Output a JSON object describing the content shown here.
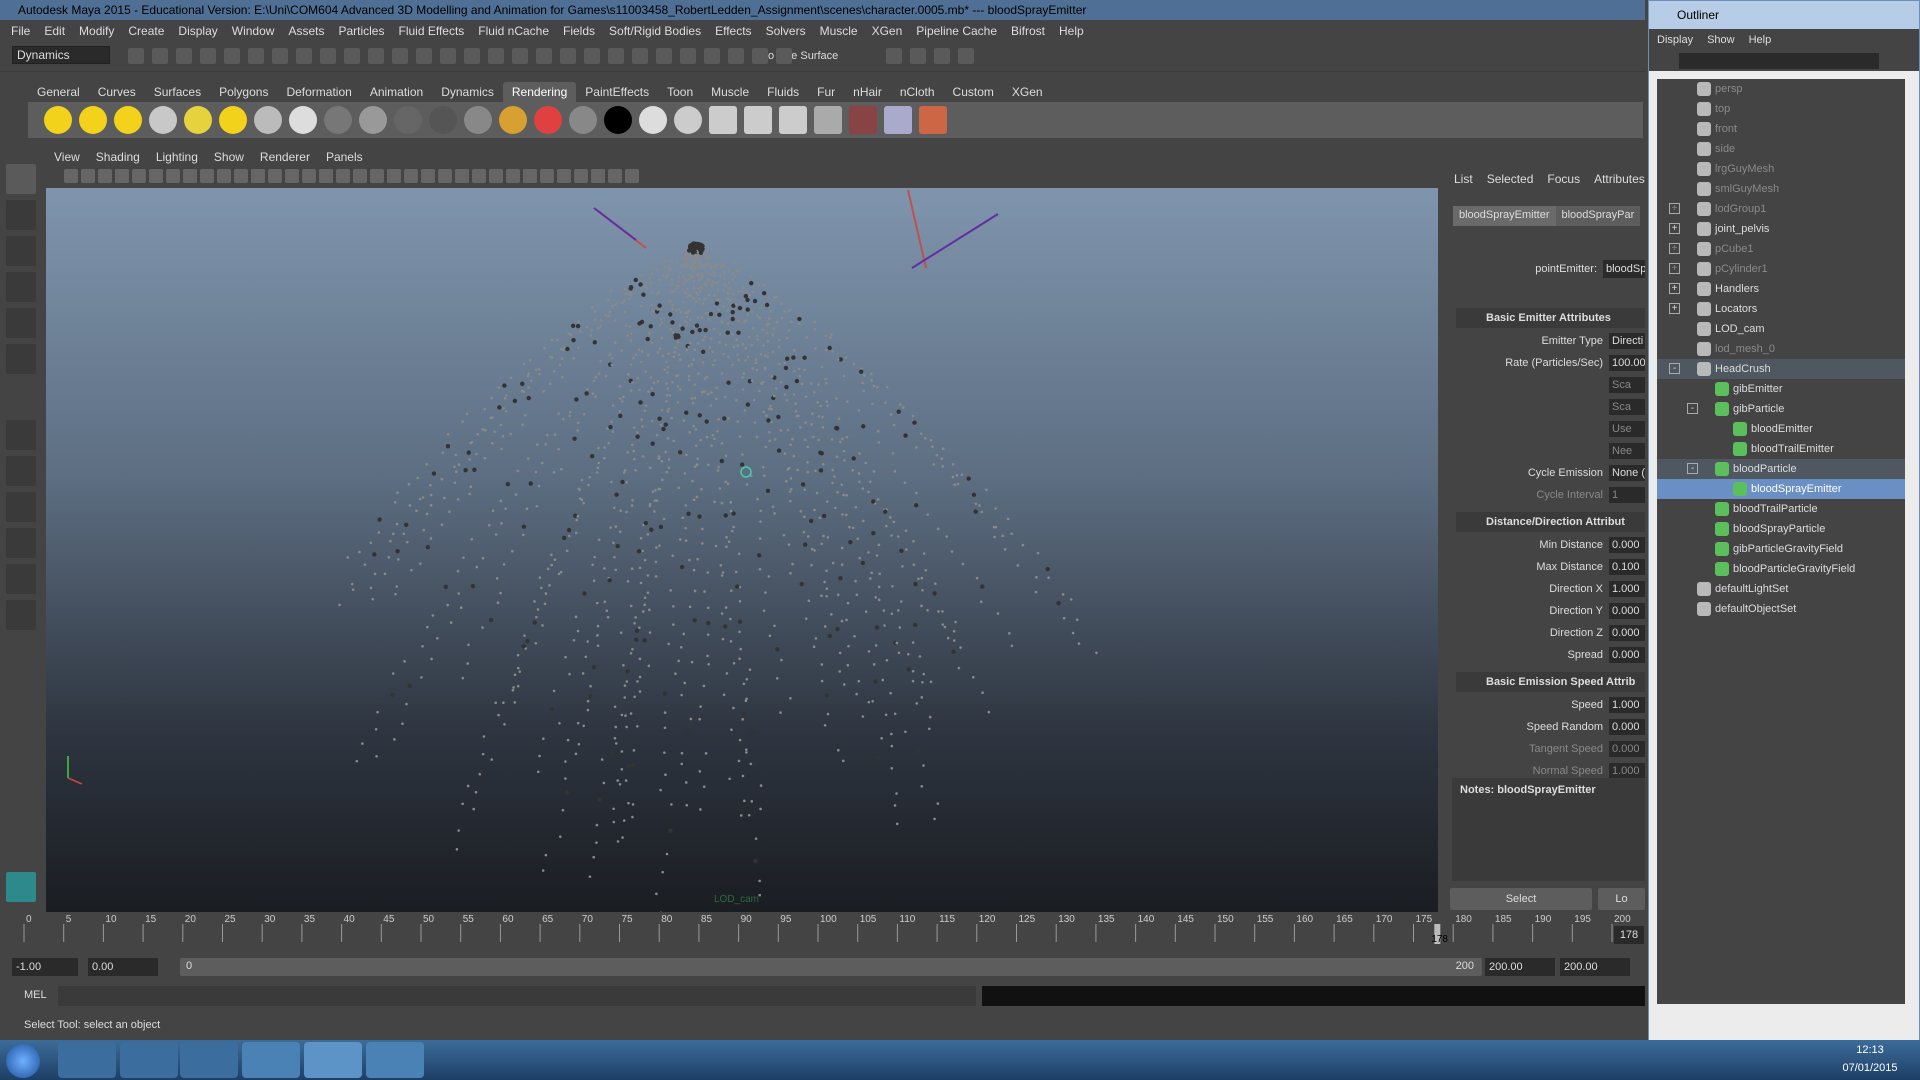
{
  "window": {
    "title": "Autodesk Maya 2015 - Educational Version: E:\\Uni\\COM604 Advanced 3D Modelling and Animation for Games\\s11003458_RobertLedden_Assignment\\scenes\\character.0005.mb* --- bloodSprayEmitter"
  },
  "menubar": [
    "File",
    "Edit",
    "Modify",
    "Create",
    "Display",
    "Window",
    "Assets",
    "Particles",
    "Fluid Effects",
    "Fluid nCache",
    "Fields",
    "Soft/Rigid Bodies",
    "Effects",
    "Solvers",
    "Muscle",
    "XGen",
    "Pipeline Cache",
    "Bifrost",
    "Help"
  ],
  "statusline": {
    "menuset": "Dynamics",
    "live_surface": "No Live Surface"
  },
  "shelf_tabs": [
    "General",
    "Curves",
    "Surfaces",
    "Polygons",
    "Deformation",
    "Animation",
    "Dynamics",
    "Rendering",
    "PaintEffects",
    "Toon",
    "Muscle",
    "Fluids",
    "Fur",
    "nHair",
    "nCloth",
    "Custom",
    "XGen"
  ],
  "shelf_active": "Rendering",
  "viewport": {
    "menu": [
      "View",
      "Shading",
      "Lighting",
      "Show",
      "Renderer",
      "Panels"
    ],
    "camera_label": "LOD_cam"
  },
  "attribute_editor": {
    "tabs": [
      "List",
      "Selected",
      "Focus",
      "Attributes"
    ],
    "node_tabs": [
      "bloodSprayEmitter",
      "bloodSprayPar"
    ],
    "type_label": "pointEmitter:",
    "type_value": "bloodSp",
    "sections": [
      {
        "title": "Basic Emitter Attributes",
        "rows": [
          {
            "label": "Emitter Type",
            "value": "Directi",
            "dim": false
          },
          {
            "label": "Rate (Particles/Sec)",
            "value": "100.00",
            "dim": false
          },
          {
            "label": "",
            "value": "Sca",
            "dim": true
          },
          {
            "label": "",
            "value": "Sca",
            "dim": true
          },
          {
            "label": "",
            "value": "Use",
            "dim": true
          },
          {
            "label": "",
            "value": "Nee",
            "dim": true
          },
          {
            "label": "Cycle Emission",
            "value": "None (",
            "dim": false
          },
          {
            "label": "Cycle Interval",
            "value": "1",
            "dim": true
          }
        ]
      },
      {
        "title": "Distance/Direction Attribut",
        "rows": [
          {
            "label": "Min Distance",
            "value": "0.000",
            "dim": false
          },
          {
            "label": "Max Distance",
            "value": "0.100",
            "dim": false
          },
          {
            "label": "Direction X",
            "value": "1.000",
            "dim": false
          },
          {
            "label": "Direction Y",
            "value": "0.000",
            "dim": false
          },
          {
            "label": "Direction Z",
            "value": "0.000",
            "dim": false
          },
          {
            "label": "Spread",
            "value": "0.000",
            "dim": false
          }
        ]
      },
      {
        "title": "Basic Emission Speed Attrib",
        "rows": [
          {
            "label": "Speed",
            "value": "1.000",
            "dim": false
          },
          {
            "label": "Speed Random",
            "value": "0.000",
            "dim": false
          },
          {
            "label": "Tangent Speed",
            "value": "0.000",
            "dim": true
          },
          {
            "label": "Normal Speed",
            "value": "1.000",
            "dim": true
          }
        ]
      }
    ],
    "notes": "Notes: bloodSprayEmitter",
    "select_button": "Select",
    "load_button": "Lo"
  },
  "outliner": {
    "title": "Outliner",
    "menu": [
      "Display",
      "Show",
      "Help"
    ],
    "items": [
      {
        "label": "persp",
        "indent": 0,
        "dim": true,
        "exp": ""
      },
      {
        "label": "top",
        "indent": 0,
        "dim": true,
        "exp": ""
      },
      {
        "label": "front",
        "indent": 0,
        "dim": true,
        "exp": ""
      },
      {
        "label": "side",
        "indent": 0,
        "dim": true,
        "exp": ""
      },
      {
        "label": "lrgGuyMesh",
        "indent": 0,
        "dim": true,
        "exp": ""
      },
      {
        "label": "smlGuyMesh",
        "indent": 0,
        "dim": true,
        "exp": ""
      },
      {
        "label": "lodGroup1",
        "indent": 0,
        "dim": true,
        "exp": "+"
      },
      {
        "label": "joint_pelvis",
        "indent": 0,
        "dim": false,
        "exp": "+"
      },
      {
        "label": "pCube1",
        "indent": 0,
        "dim": true,
        "exp": "+"
      },
      {
        "label": "pCylinder1",
        "indent": 0,
        "dim": true,
        "exp": "+"
      },
      {
        "label": "Handlers",
        "indent": 0,
        "dim": false,
        "exp": "+"
      },
      {
        "label": "Locators",
        "indent": 0,
        "dim": false,
        "exp": "+"
      },
      {
        "label": "LOD_cam",
        "indent": 0,
        "dim": false,
        "exp": ""
      },
      {
        "label": "lod_mesh_0",
        "indent": 0,
        "dim": true,
        "exp": ""
      },
      {
        "label": "HeadCrush",
        "indent": 0,
        "dim": false,
        "exp": "-",
        "hl": true
      },
      {
        "label": "gibEmitter",
        "indent": 1,
        "dim": false,
        "exp": ""
      },
      {
        "label": "gibParticle",
        "indent": 1,
        "dim": false,
        "exp": "-"
      },
      {
        "label": "bloodEmitter",
        "indent": 2,
        "dim": false,
        "exp": ""
      },
      {
        "label": "bloodTrailEmitter",
        "indent": 2,
        "dim": false,
        "exp": ""
      },
      {
        "label": "bloodParticle",
        "indent": 1,
        "dim": false,
        "exp": "-",
        "hl": true
      },
      {
        "label": "bloodSprayEmitter",
        "indent": 2,
        "dim": false,
        "exp": "",
        "sel": true
      },
      {
        "label": "bloodTrailParticle",
        "indent": 1,
        "dim": false,
        "exp": ""
      },
      {
        "label": "bloodSprayParticle",
        "indent": 1,
        "dim": false,
        "exp": ""
      },
      {
        "label": "gibParticleGravityField",
        "indent": 1,
        "dim": false,
        "exp": ""
      },
      {
        "label": "bloodParticleGravityField",
        "indent": 1,
        "dim": false,
        "exp": ""
      },
      {
        "label": "defaultLightSet",
        "indent": 0,
        "dim": false,
        "exp": ""
      },
      {
        "label": "defaultObjectSet",
        "indent": 0,
        "dim": false,
        "exp": ""
      }
    ]
  },
  "timeline": {
    "ticks": [
      "0",
      "5",
      "10",
      "15",
      "20",
      "25",
      "30",
      "35",
      "40",
      "45",
      "50",
      "55",
      "60",
      "65",
      "70",
      "75",
      "80",
      "85",
      "90",
      "95",
      "100",
      "105",
      "110",
      "115",
      "120",
      "125",
      "130",
      "135",
      "140",
      "145",
      "150",
      "155",
      "160",
      "165",
      "170",
      "175",
      "180",
      "185",
      "190",
      "195",
      "200"
    ],
    "current_frame": "178",
    "current_frame_field": "178"
  },
  "range": {
    "start": "-1.00",
    "playback_start": "0.00",
    "slider_start": "0",
    "slider_end": "200",
    "playback_end": "200.00",
    "end": "200.00"
  },
  "command": {
    "label": "MEL"
  },
  "help_line": "Select Tool: select an object",
  "taskbar": {
    "time": "12:13",
    "date": "07/01/2015"
  },
  "colors": {
    "accent": "#6a8fc4",
    "title": "#4f6f95"
  }
}
